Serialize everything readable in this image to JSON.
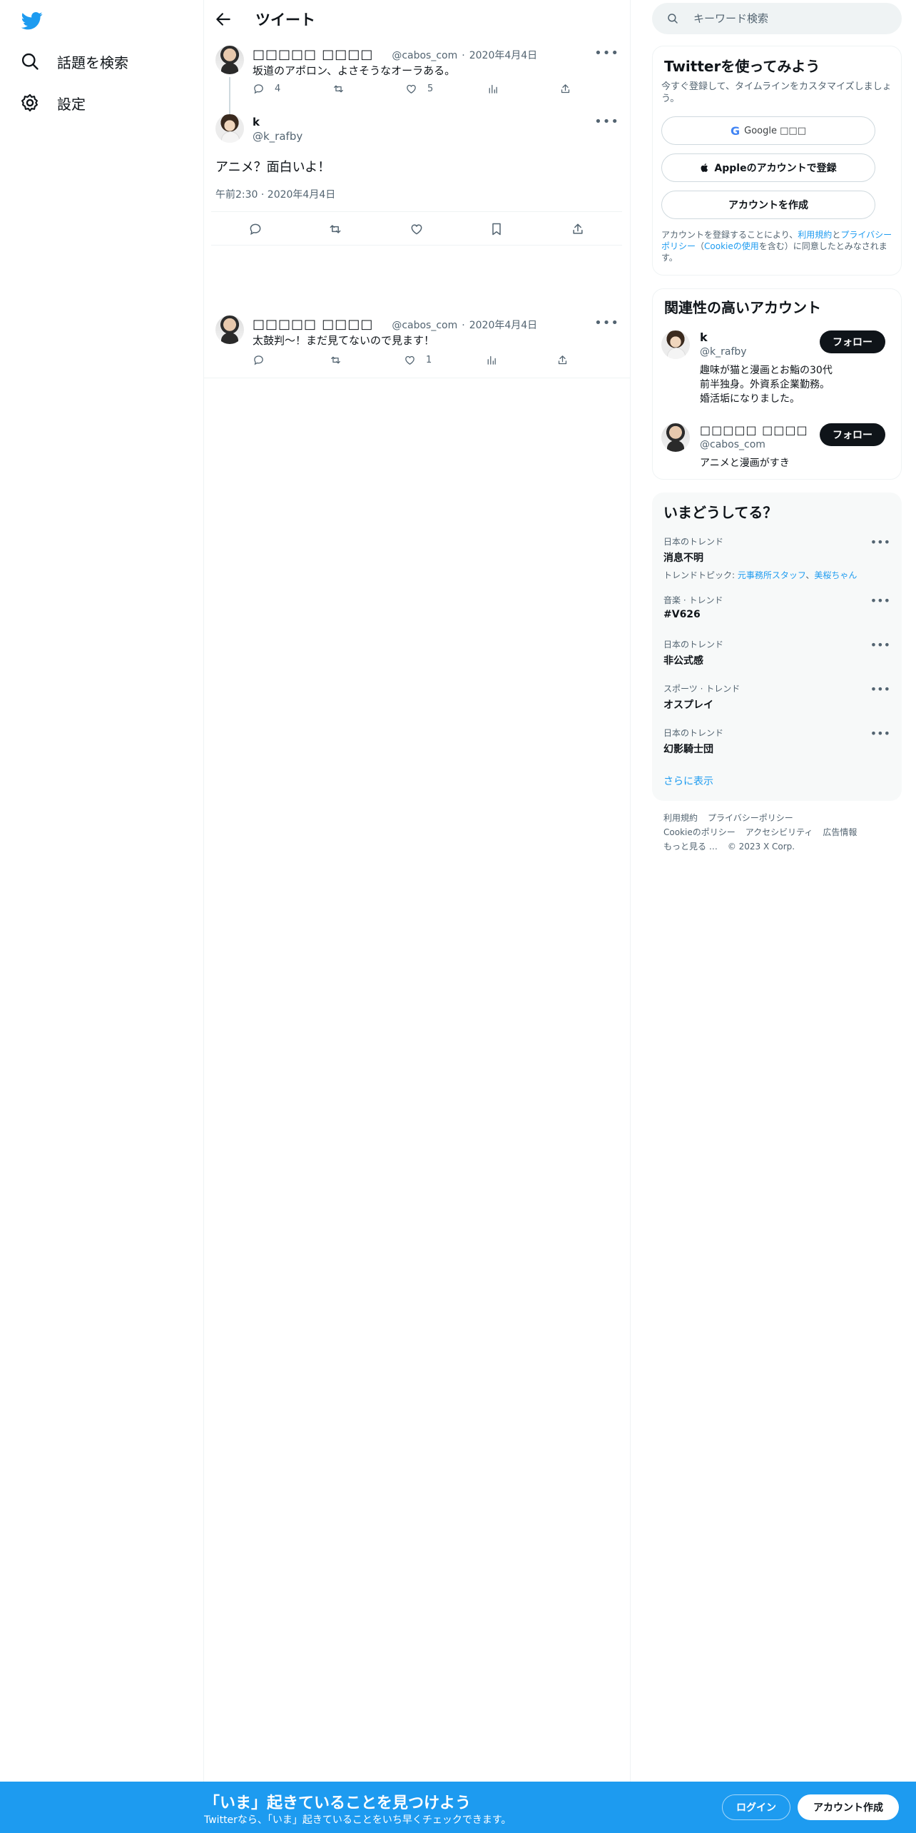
{
  "nav": {
    "explore_label": "話題を検索",
    "settings_label": "設定"
  },
  "header": {
    "title": "ツイート"
  },
  "tweets": [
    {
      "name": "□□□□□ □□□□",
      "handle": "@cabos_com",
      "dot": "·",
      "date": "2020年4月4日",
      "text": "坂道のアポロン、よさそうなオーラある。",
      "replies": "4",
      "likes": "5"
    },
    {
      "name": "□□□□□ □□□□",
      "handle": "@cabos_com",
      "dot": "·",
      "date": "2020年4月4日",
      "text": "太鼓判〜！まだ見てないので見ます！",
      "replies": "",
      "likes": "1"
    }
  ],
  "main_tweet": {
    "name": "k",
    "handle": "@k_rafby",
    "text": "アニメ？面白いよ！",
    "time": "午前2:30 · 2020年4月4日"
  },
  "search": {
    "placeholder": "キーワード検索"
  },
  "signup": {
    "title": "Twitterを使ってみよう",
    "subtitle": "今すぐ登録して、タイムラインをカスタマイズしましょう。",
    "google_label": "Google □□□",
    "apple_label": "Appleのアカウントで登録",
    "create_label": "アカウントを作成",
    "legal_1": "アカウントを登録することにより、",
    "legal_terms": "利用規約",
    "legal_2": "と",
    "legal_privacy": "プライバシーポリシー",
    "legal_3": "（",
    "legal_cookie": "Cookieの使用",
    "legal_4": "を含む）に同意したとみなされます。"
  },
  "relevant": {
    "title": "関連性の高いアカウント",
    "follow_label": "フォロー",
    "accounts": [
      {
        "name": "k",
        "handle": "@k_rafby",
        "bio": "趣味が猫と漫画とお鮨の30代前半独身。外資系企業勤務。婚活垢になりました。"
      },
      {
        "name": "□□□□□ □□□□",
        "handle": "@cabos_com",
        "bio": "アニメと漫画がすき"
      }
    ]
  },
  "trends": {
    "title": "いまどうしてる？",
    "items": [
      {
        "category": "日本のトレンド",
        "name": "消息不明",
        "topic_prefix": "トレンドトピック: ",
        "topic_1": "元事務所スタッフ",
        "topic_sep": "、",
        "topic_2": "美桜ちゃん"
      },
      {
        "category": "音楽 · トレンド",
        "name": "#V626"
      },
      {
        "category": "日本のトレンド",
        "name": "非公式感"
      },
      {
        "category": "スポーツ · トレンド",
        "name": "オスプレイ"
      },
      {
        "category": "日本のトレンド",
        "name": "幻影騎士団"
      }
    ],
    "show_more": "さらに表示"
  },
  "footer": {
    "terms": "利用規約",
    "privacy": "プライバシーポリシー",
    "cookie": "Cookieのポリシー",
    "accessibility": "アクセシビリティ",
    "ads": "広告情報",
    "more": "もっと見る …",
    "copyright": "© 2023 X Corp."
  },
  "banner": {
    "title": "「いま」起きていることを見つけよう",
    "subtitle": "Twitterなら、「いま」起きていることをいち早くチェックできます。",
    "login_label": "ログイン",
    "signup_label": "アカウント作成"
  },
  "colors": {
    "accent": "#1d9bf0",
    "text": "#0f1419",
    "muted": "#536471"
  }
}
